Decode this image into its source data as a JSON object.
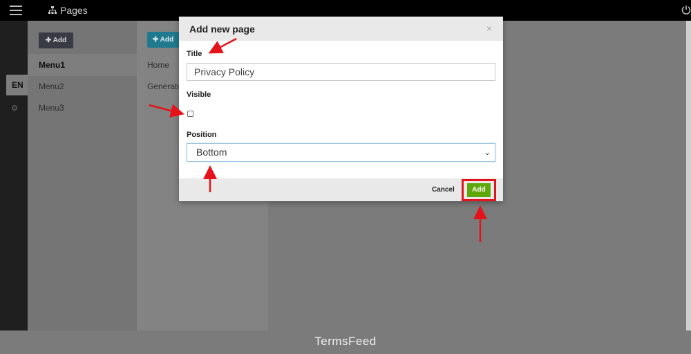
{
  "topbar": {
    "title": "Pages"
  },
  "rail": {
    "lang": "EN"
  },
  "menus": {
    "add_label": "Add",
    "items": [
      "Menu1",
      "Menu2",
      "Menu3"
    ]
  },
  "pages": {
    "add_label": "Add",
    "items": [
      "Home",
      "Generato"
    ]
  },
  "modal": {
    "title": "Add new page",
    "close": "×",
    "title_label": "Title",
    "title_value": "Privacy Policy",
    "visible_label": "Visible",
    "visible_checked": false,
    "position_label": "Position",
    "position_value": "Bottom",
    "cancel_label": "Cancel",
    "add_label": "Add"
  },
  "footer": {
    "text": "TermsFeed"
  },
  "colors": {
    "accent_green": "#5ea80b",
    "highlight_red": "#e4131a",
    "teal": "#207a8f"
  }
}
